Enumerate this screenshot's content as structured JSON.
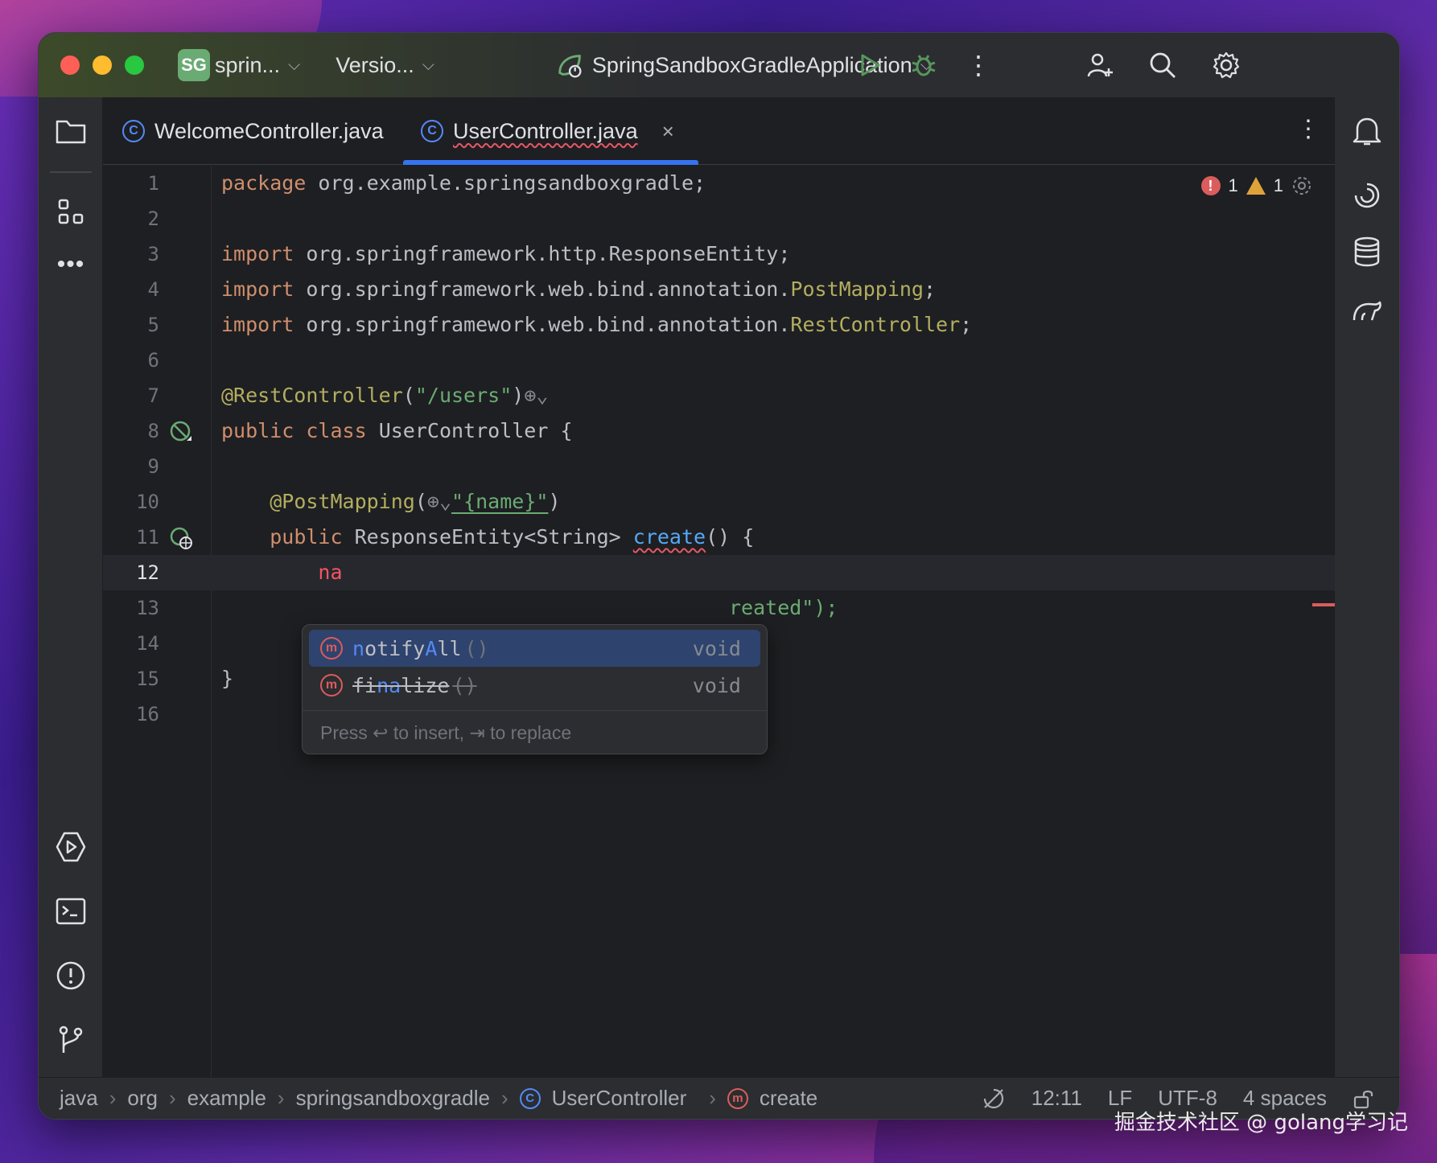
{
  "titlebar": {
    "project_badge": "SG",
    "project_name": "sprin...",
    "vcs_label": "Versio...",
    "run_config": "SpringSandboxGradleApplication"
  },
  "tabs": [
    {
      "label": "WelcomeController.java",
      "icon": "C"
    },
    {
      "label": "UserController.java",
      "icon": "C",
      "close": "×"
    }
  ],
  "inspections": {
    "errors": "1",
    "warnings": "1"
  },
  "gutter_numbers": [
    "1",
    "2",
    "3",
    "4",
    "5",
    "6",
    "7",
    "8",
    "9",
    "10",
    "11",
    "12",
    "13",
    "14",
    "15",
    "16"
  ],
  "code": {
    "l1_kw": "package",
    "l1_rest": " org.example.springsandboxgradle;",
    "l3_kw": "import",
    "l3_rest": " org.springframework.http.ResponseEntity;",
    "l4_kw": "import",
    "l4_pkg": " org.springframework.web.bind.annotation.",
    "l4_cls": "PostMapping",
    "l4_end": ";",
    "l5_kw": "import",
    "l5_pkg": " org.springframework.web.bind.annotation.",
    "l5_cls": "RestController",
    "l5_end": ";",
    "l7_ann": "@RestController",
    "l7_open": "(",
    "l7_str": "\"/users\"",
    "l7_close": ")",
    "l8_kw1": "public",
    "l8_kw2": "class",
    "l8_rest": " UserController {",
    "l10_ann": "@PostMapping",
    "l10_open": "(",
    "l10_str": "\"{name}\"",
    "l10_close": ")",
    "l11_kw": "public",
    "l11_type": " ResponseEntity<String> ",
    "l11_fn": "create",
    "l11_end": "() {",
    "l12_typed": "na",
    "l13_tail": "reated\");",
    "l15": "}"
  },
  "completion": {
    "items": [
      {
        "prefix": "",
        "hl": "n",
        "mid": "otify",
        "hl2": "A",
        "suffix": "ll",
        "parens": "()",
        "type": "void",
        "selected": true
      },
      {
        "prefix": "fi",
        "hl": "na",
        "mid": "lize",
        "hl2": "",
        "suffix": "",
        "parens": "()",
        "type": "void",
        "deprecated": true
      }
    ],
    "hint": "Press ↩ to insert, ⇥ to replace",
    "method_icon": "m"
  },
  "statusbar": {
    "breadcrumbs": [
      "java",
      "org",
      "example",
      "springsandboxgradle",
      "UserController",
      "create"
    ],
    "separator": "›",
    "position": "12:11",
    "line_ending": "LF",
    "encoding": "UTF-8",
    "indent": "4 spaces"
  },
  "watermark": "掘金技术社区 @ golang学习记",
  "colors": {
    "accent": "#3574f0",
    "keyword": "#cf8e6d",
    "annotation": "#b3ae60",
    "string": "#6aab73",
    "error": "#db5c5c"
  }
}
